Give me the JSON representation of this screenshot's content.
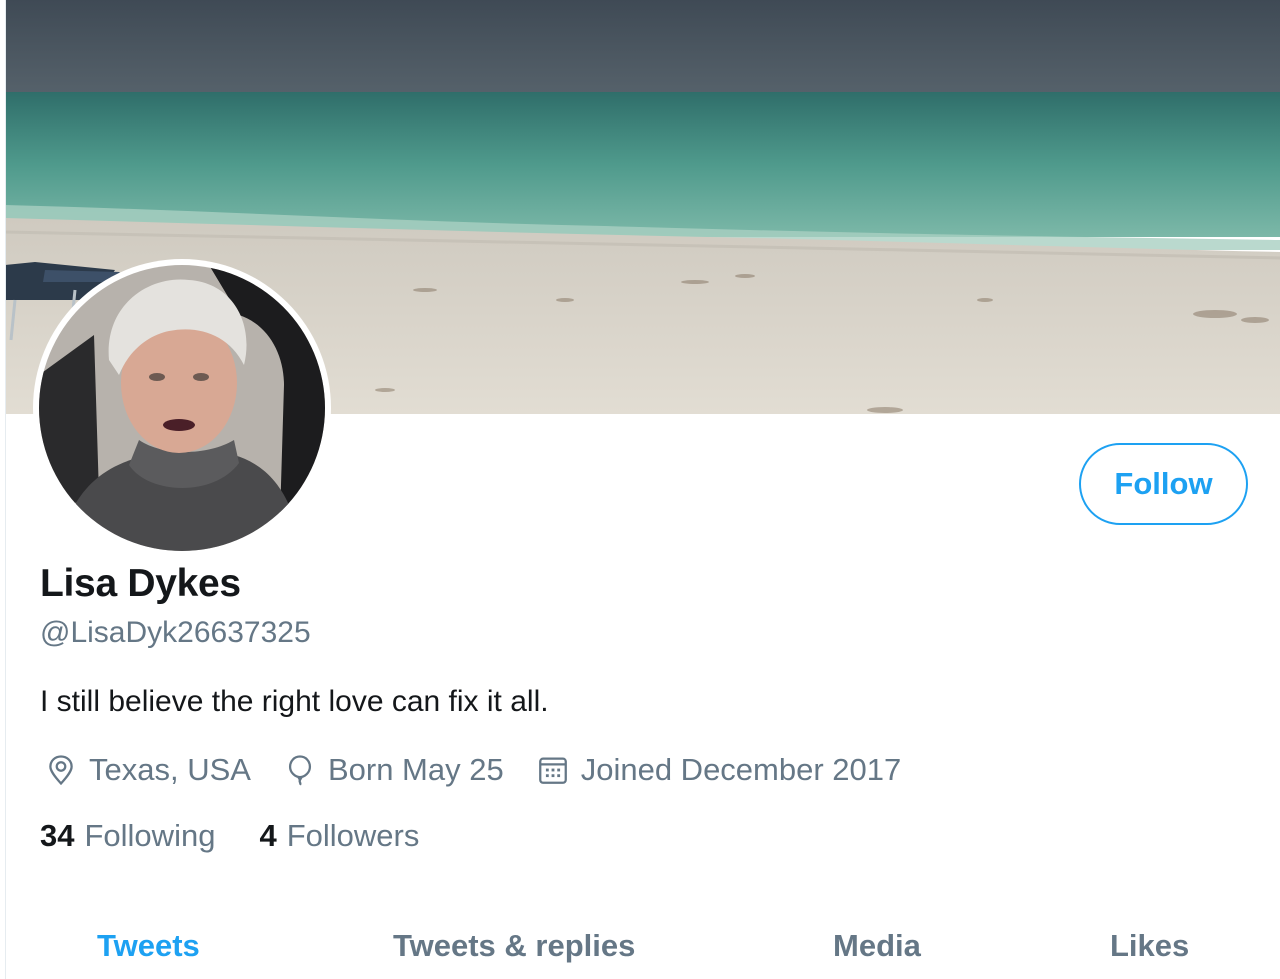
{
  "profile": {
    "display_name": "Lisa Dykes",
    "handle": "@LisaDyk26637325",
    "bio": "I still believe the right love can fix it all.",
    "location": "Texas, USA",
    "birthday": "Born May 25",
    "joined": "Joined December 2017"
  },
  "stats": {
    "following_count": "34",
    "following_label": "Following",
    "followers_count": "4",
    "followers_label": "Followers"
  },
  "actions": {
    "follow_label": "Follow"
  },
  "tabs": [
    {
      "label": "Tweets",
      "active": true
    },
    {
      "label": "Tweets & replies",
      "active": false
    },
    {
      "label": "Media",
      "active": false
    },
    {
      "label": "Likes",
      "active": false
    }
  ],
  "icons": {
    "location": "location-pin-icon",
    "birthday": "balloon-icon",
    "joined": "calendar-icon"
  },
  "colors": {
    "accent": "#1da1f2",
    "primary_text": "#14171a",
    "secondary_text": "#657786"
  }
}
